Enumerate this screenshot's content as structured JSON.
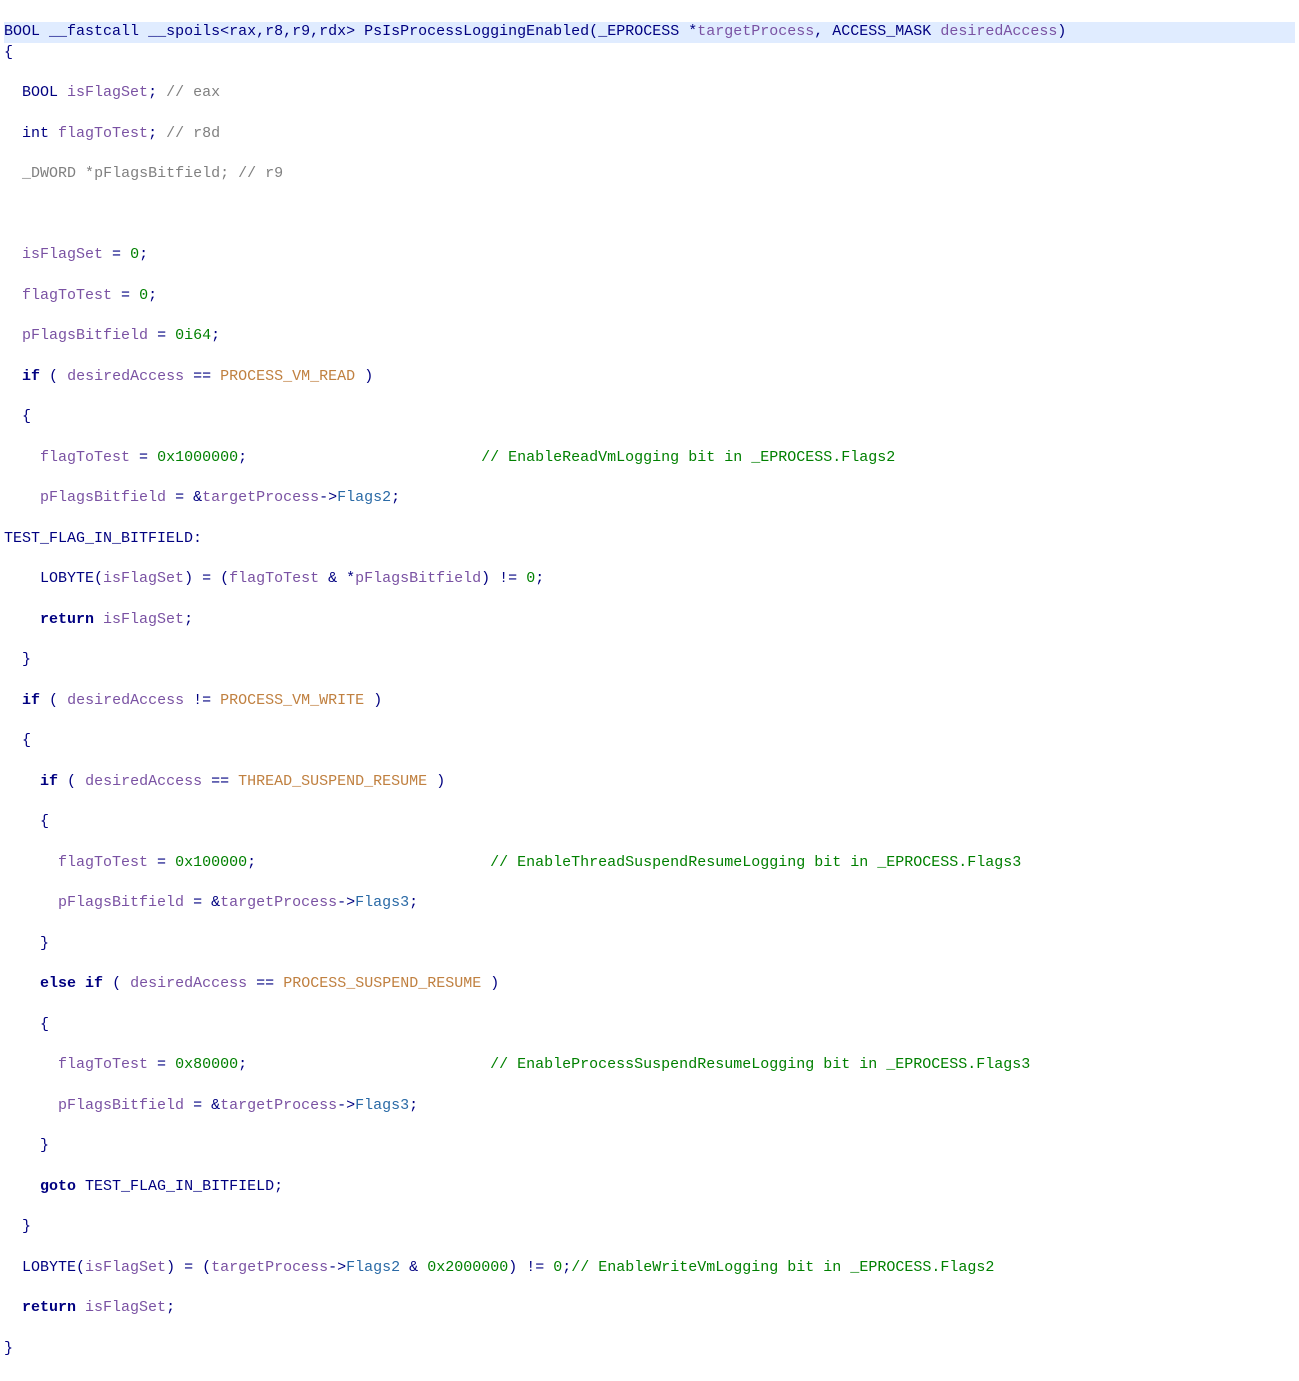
{
  "sig": {
    "ret": "BOOL",
    "cc1": "__fastcall",
    "cc2": "__spoils",
    "spoils": "<rax,r8,r9,rdx>",
    "name": "PsIsProcessLoggingEnabled",
    "p1_type": "_EPROCESS",
    "p1_name": "targetProcess",
    "p2_type": "ACCESS_MASK",
    "p2_name": "desiredAccess"
  },
  "decls": {
    "d1_type": "BOOL",
    "d1_name": "isFlagSet",
    "d1_reg": "// eax",
    "d2_type": "int",
    "d2_name": "flagToTest",
    "d2_reg": "// r8d",
    "d3_type": "_DWORD",
    "d3_name": "pFlagsBitfield",
    "d3_reg": "// r9"
  },
  "init": {
    "v1": "isFlagSet",
    "n1": "0",
    "v2": "flagToTest",
    "n2": "0",
    "v3": "pFlagsBitfield",
    "n3": "0i64"
  },
  "kw": {
    "if": "if",
    "else": "else",
    "return": "return",
    "goto": "goto"
  },
  "c1": {
    "var": "desiredAccess",
    "cmp": "PROCESS_VM_READ",
    "flag_val": "0x1000000",
    "flag_var": "flagToTest",
    "ptr_var": "pFlagsBitfield",
    "tgt": "targetProcess",
    "member": "Flags2",
    "comment": "// EnableReadVmLogging bit in _EPROCESS.Flags2"
  },
  "label": {
    "name": "TEST_FLAG_IN_BITFIELD",
    "lobyte": "LOBYTE",
    "res": "isFlagSet",
    "a": "flagToTest",
    "b": "pFlagsBitfield",
    "zero": "0"
  },
  "c2": {
    "var": "desiredAccess",
    "cmp": "PROCESS_VM_WRITE"
  },
  "c3": {
    "var": "desiredAccess",
    "cmp": "THREAD_SUSPEND_RESUME",
    "flag_val": "0x100000",
    "flag_var": "flagToTest",
    "ptr_var": "pFlagsBitfield",
    "tgt": "targetProcess",
    "member": "Flags3",
    "comment": "// EnableThreadSuspendResumeLogging bit in _EPROCESS.Flags3"
  },
  "c4": {
    "var": "desiredAccess",
    "cmp": "PROCESS_SUSPEND_RESUME",
    "flag_val": "0x80000",
    "flag_var": "flagToTest",
    "ptr_var": "pFlagsBitfield",
    "tgt": "targetProcess",
    "member": "Flags3",
    "comment": "// EnableProcessSuspendResumeLogging bit in _EPROCESS.Flags3"
  },
  "gotoStmt": {
    "target": "TEST_FLAG_IN_BITFIELD"
  },
  "writevm": {
    "lobyte": "LOBYTE",
    "res": "isFlagSet",
    "tgt": "targetProcess",
    "member": "Flags2",
    "mask": "0x2000000",
    "zero": "0",
    "comment": "// EnableWriteVmLogging bit in _EPROCESS.Flags2"
  },
  "ret": {
    "var": "isFlagSet"
  }
}
